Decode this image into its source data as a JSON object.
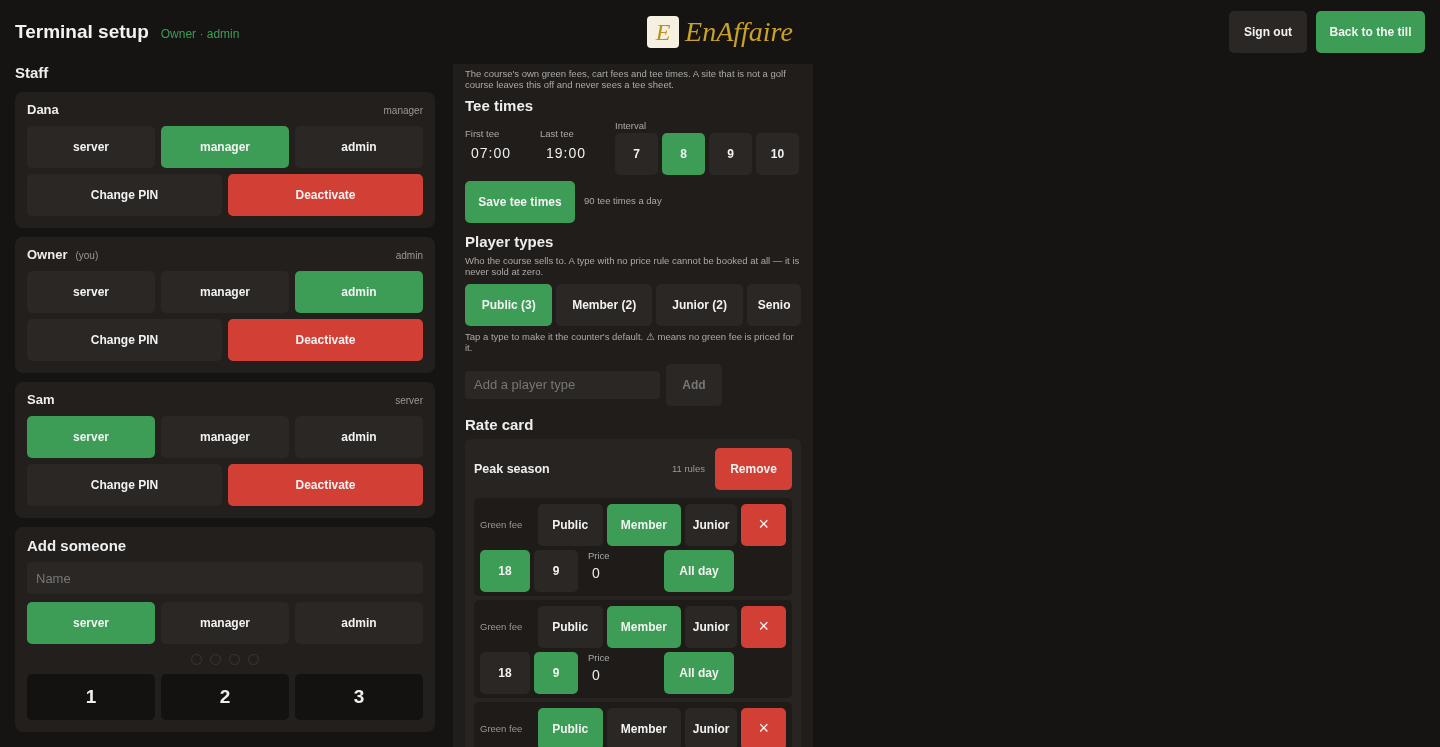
{
  "header": {
    "title": "Terminal setup",
    "subtitle": "Owner · admin",
    "logo_letter": "E",
    "logo_text": "EnAffaire",
    "buttons": [
      {
        "label": "Sign out",
        "kind": "secondary"
      },
      {
        "label": "Back to the till",
        "kind": "primary"
      }
    ]
  },
  "staff": {
    "heading": "Staff",
    "members": [
      {
        "name": "Dana",
        "role": "manager",
        "roles": [
          {
            "label": "server",
            "selected": false
          },
          {
            "label": "manager",
            "selected": true
          },
          {
            "label": "admin",
            "selected": false
          }
        ],
        "actions": [
          {
            "label": "Change PIN",
            "kind": "secondary"
          },
          {
            "label": "Deactivate",
            "kind": "danger"
          }
        ]
      },
      {
        "name": "Owner",
        "note": "(you)",
        "role": "admin",
        "roles": [
          {
            "label": "server",
            "selected": false
          },
          {
            "label": "manager",
            "selected": false
          },
          {
            "label": "admin",
            "selected": true
          }
        ],
        "actions": [
          {
            "label": "Change PIN",
            "kind": "secondary"
          },
          {
            "label": "Deactivate",
            "kind": "danger"
          }
        ]
      },
      {
        "name": "Sam",
        "role": "server",
        "roles": [
          {
            "label": "server",
            "selected": true
          },
          {
            "label": "manager",
            "selected": false
          },
          {
            "label": "admin",
            "selected": false
          }
        ],
        "actions": [
          {
            "label": "Change PIN",
            "kind": "secondary"
          },
          {
            "label": "Deactivate",
            "kind": "danger"
          }
        ]
      }
    ]
  },
  "add_someone": {
    "heading": "Add someone",
    "name_placeholder": "Name",
    "roles": [
      {
        "label": "server",
        "selected": true
      },
      {
        "label": "manager",
        "selected": false
      },
      {
        "label": "admin",
        "selected": false
      }
    ],
    "pin_dots": [
      {
        "filled": false
      },
      {
        "filled": false
      },
      {
        "filled": false
      },
      {
        "filled": false
      }
    ],
    "keypad": [
      "1",
      "2",
      "3"
    ]
  },
  "golf": {
    "intro": "The course's own green fees, cart fees and tee times. A site that is not a golf course leaves this off and never sees a tee sheet.",
    "tee_times": {
      "heading": "Tee times",
      "first": {
        "label": "First tee",
        "value": "07:00"
      },
      "last": {
        "label": "Last tee",
        "value": "19:00"
      },
      "interval": {
        "label": "Interval",
        "options": [
          {
            "label": "7",
            "selected": false
          },
          {
            "label": "8",
            "selected": true
          },
          {
            "label": "9",
            "selected": false
          },
          {
            "label": "10",
            "selected": false
          }
        ]
      },
      "save_button": "Save tee times",
      "summary": "90 tee times a day"
    },
    "player_types": {
      "heading": "Player types",
      "description": "Who the course sells to. A type with no price rule cannot be booked at all — it is never sold at zero.",
      "types": [
        {
          "label": "Public  (3)",
          "selected": true
        },
        {
          "label": "Member  (2)",
          "selected": false
        },
        {
          "label": "Junior  (2)",
          "selected": false
        },
        {
          "label": "Senio",
          "selected": false
        }
      ],
      "hint": "Tap a type to make it the counter's default. ⚠ means no green fee is priced for it.",
      "add_placeholder": "Add a player type",
      "add_button": {
        "label": "Add",
        "disabled": true
      }
    },
    "rate_card": {
      "heading": "Rate card",
      "seasons": [
        {
          "name": "Peak season",
          "count": "11 rules",
          "remove": "Remove",
          "rules": [
            {
              "label": "Green fee",
              "types": [
                {
                  "label": "Public",
                  "selected": false
                },
                {
                  "label": "Member",
                  "selected": true
                },
                {
                  "label": "Junior",
                  "selected": false
                }
              ],
              "delete": "×",
              "holes": [
                {
                  "label": "18",
                  "selected": true
                },
                {
                  "label": "9",
                  "selected": false
                }
              ],
              "price_label": "Price",
              "price": "0",
              "time_button": "All day"
            },
            {
              "label": "Green fee",
              "types": [
                {
                  "label": "Public",
                  "selected": false
                },
                {
                  "label": "Member",
                  "selected": true
                },
                {
                  "label": "Junior",
                  "selected": false
                }
              ],
              "delete": "×",
              "holes": [
                {
                  "label": "18",
                  "selected": false
                },
                {
                  "label": "9",
                  "selected": true
                }
              ],
              "price_label": "Price",
              "price": "0",
              "time_button": "All day"
            },
            {
              "label": "Green fee",
              "types": [
                {
                  "label": "Public",
                  "selected": true
                },
                {
                  "label": "Member",
                  "selected": false
                },
                {
                  "label": "Junior",
                  "selected": false
                }
              ],
              "delete": "×"
            }
          ]
        }
      ]
    }
  }
}
